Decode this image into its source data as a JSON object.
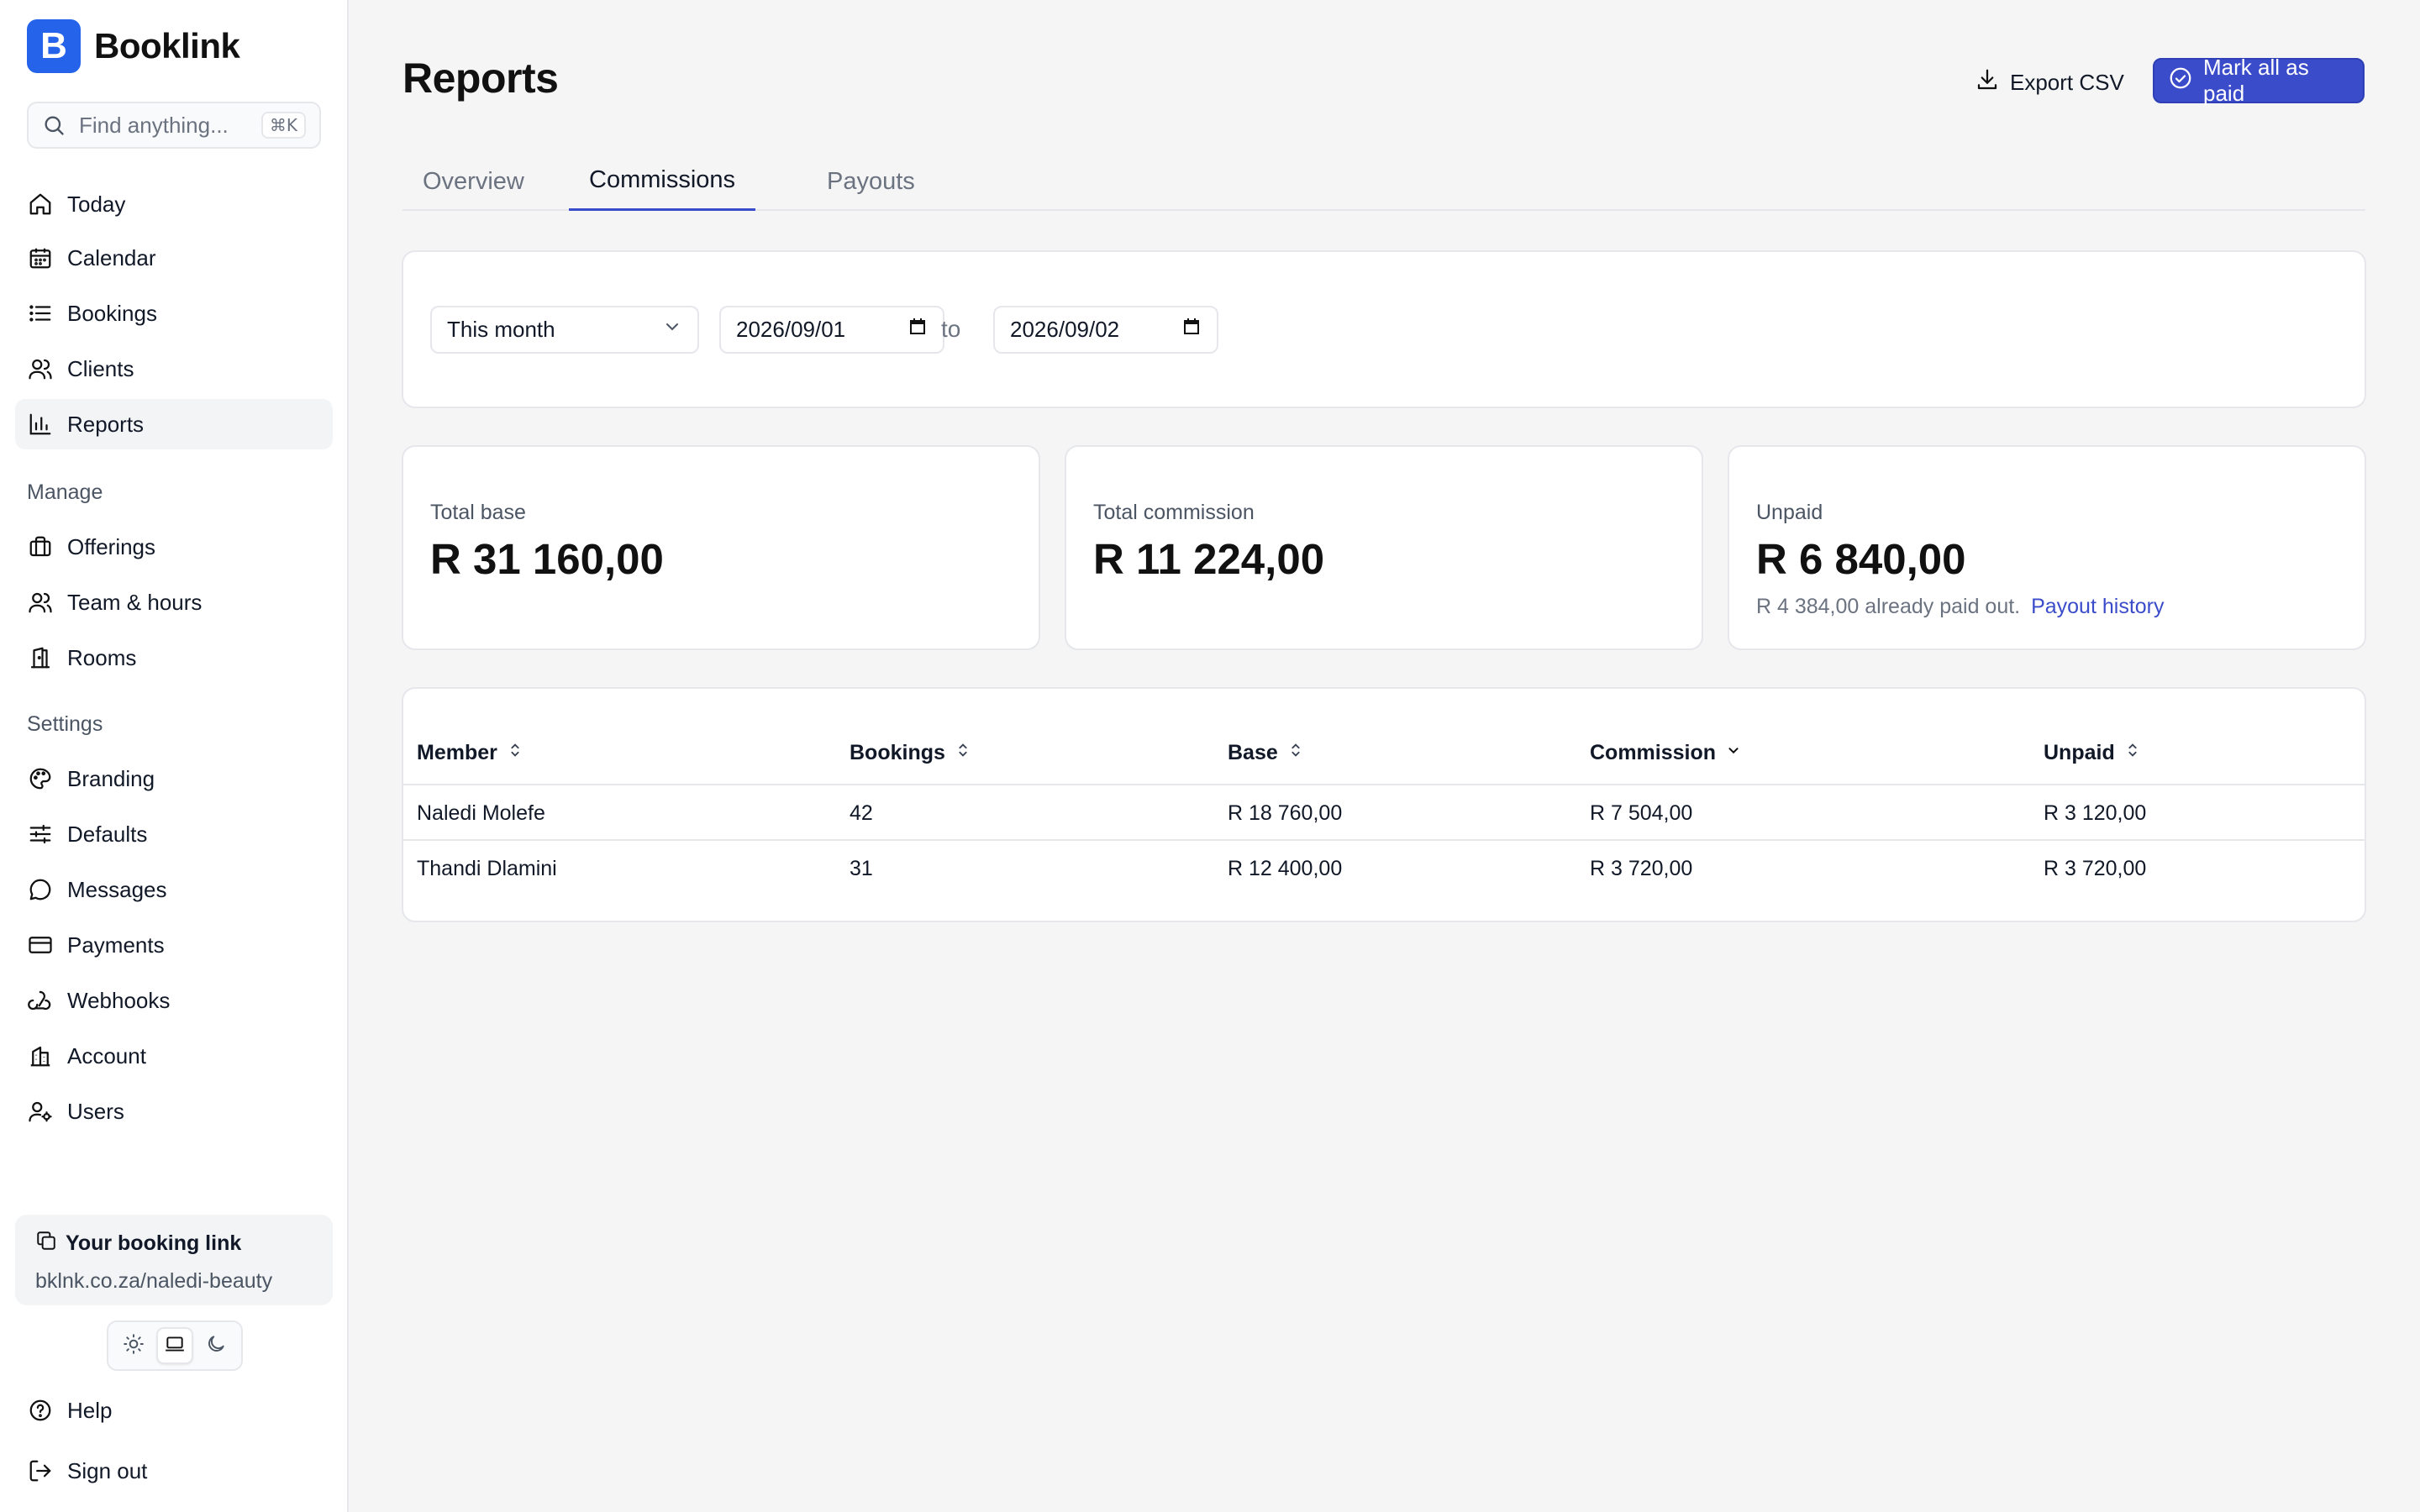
{
  "app": {
    "name": "Booklink",
    "logo_letter": "B",
    "accent": "#3b4cca",
    "brand_color": "#2563eb"
  },
  "search": {
    "placeholder": "Find anything...",
    "shortcut": "⌘K"
  },
  "nav": {
    "primary": [
      {
        "label": "Today",
        "icon": "home-icon"
      },
      {
        "label": "Calendar",
        "icon": "calendar-icon"
      },
      {
        "label": "Bookings",
        "icon": "list-icon"
      },
      {
        "label": "Clients",
        "icon": "users-icon"
      },
      {
        "label": "Reports",
        "icon": "bar-chart-icon",
        "active": true
      }
    ],
    "manage_title": "Manage",
    "manage": [
      {
        "label": "Offerings",
        "icon": "briefcase-icon"
      },
      {
        "label": "Team & hours",
        "icon": "team-icon"
      },
      {
        "label": "Rooms",
        "icon": "door-icon"
      }
    ],
    "settings_title": "Settings",
    "settings": [
      {
        "label": "Branding",
        "icon": "palette-icon"
      },
      {
        "label": "Defaults",
        "icon": "sliders-icon"
      },
      {
        "label": "Messages",
        "icon": "message-icon"
      },
      {
        "label": "Payments",
        "icon": "credit-card-icon"
      },
      {
        "label": "Webhooks",
        "icon": "webhook-icon"
      },
      {
        "label": "Account",
        "icon": "building-icon"
      },
      {
        "label": "Users",
        "icon": "user-cog-icon"
      }
    ],
    "footer": [
      {
        "label": "Help",
        "icon": "help-icon"
      },
      {
        "label": "Sign out",
        "icon": "sign-out-icon"
      }
    ]
  },
  "booking_link": {
    "title": "Your booking link",
    "url": "bklnk.co.za/naledi-beauty"
  },
  "theme": {
    "options": [
      "light",
      "system",
      "dark"
    ],
    "selected": "system"
  },
  "page": {
    "title": "Reports",
    "export_label": "Export CSV",
    "mark_paid_label": "Mark all as paid",
    "tabs": [
      {
        "label": "Overview"
      },
      {
        "label": "Commissions",
        "active": true
      },
      {
        "label": "Payouts"
      }
    ]
  },
  "filters": {
    "period": "This month",
    "from": "2026/09/01",
    "to_label": "to",
    "to": "2026/09/02"
  },
  "stats": {
    "total_base": {
      "label": "Total base",
      "value": "R 31 160,00"
    },
    "total_commission": {
      "label": "Total commission",
      "value": "R 11 224,00"
    },
    "unpaid": {
      "label": "Unpaid",
      "value": "R 6 840,00",
      "note": "R 4 384,00 already paid out.",
      "link": "Payout history"
    }
  },
  "table": {
    "columns": [
      "Member",
      "Bookings",
      "Base",
      "Commission",
      "Unpaid"
    ],
    "sorted_column": "Commission",
    "rows": [
      [
        "Naledi Molefe",
        "42",
        "R 18 760,00",
        "R 7 504,00",
        "R 3 120,00"
      ],
      [
        "Thandi Dlamini",
        "31",
        "R 12 400,00",
        "R 3 720,00",
        "R 3 720,00"
      ]
    ]
  }
}
